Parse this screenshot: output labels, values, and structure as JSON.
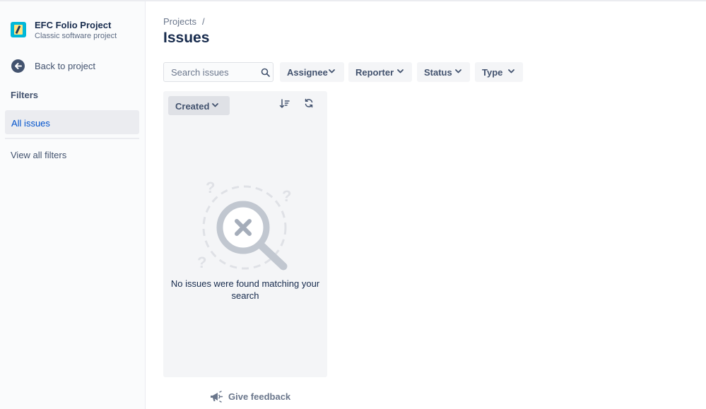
{
  "sidebar": {
    "project_name": "EFC Folio Project",
    "project_type": "Classic software project",
    "back_label": "Back to project",
    "filters_heading": "Filters",
    "all_issues_label": "All issues",
    "view_all_filters_label": "View all filters"
  },
  "header": {
    "breadcrumb": "Projects",
    "breadcrumb_separator": "/",
    "title": "Issues"
  },
  "search": {
    "placeholder": "Search issues",
    "value": ""
  },
  "filters": {
    "assignee": "Assignee",
    "reporter": "Reporter",
    "status": "Status",
    "type": "Type"
  },
  "results": {
    "sort_label": "Created",
    "empty_message": "No issues were found matching your search"
  },
  "footer": {
    "feedback_label": "Give feedback"
  },
  "icons": {
    "search": "search-icon",
    "back": "arrow-left-icon",
    "chevron": "chevron-down-icon",
    "sort": "sort-order-icon",
    "refresh": "refresh-icon",
    "feedback": "megaphone-icon"
  },
  "colors": {
    "link": "#0052cc",
    "text": "#172b4d",
    "subtle": "#42526e",
    "panel": "#f4f5f7",
    "project_icon": "#00b8d9"
  }
}
